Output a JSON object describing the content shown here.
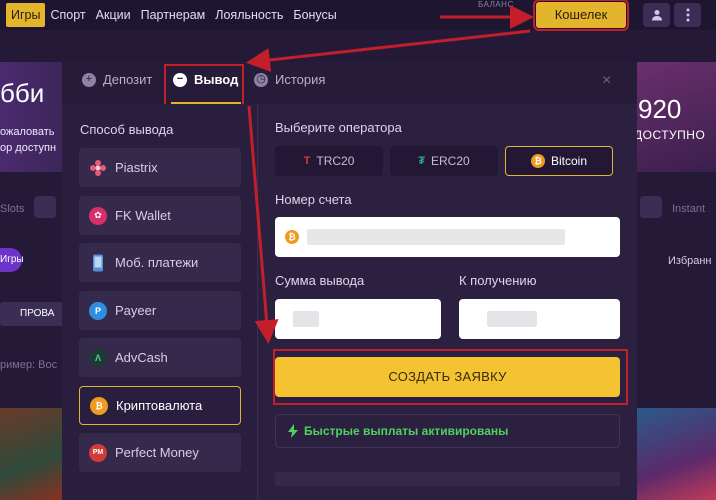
{
  "nav": {
    "items": [
      "Игры",
      "Спорт",
      "Акции",
      "Партнерам",
      "Лояльность",
      "Бонусы"
    ],
    "balance_label": "БАЛАНС",
    "wallet_button": "Кошелек"
  },
  "background": {
    "hero_text": "бби",
    "hero_line1": "ожаловать",
    "hero_line2": "ор доступн",
    "right_number": "920",
    "right_caption": "ДОСТУПНО",
    "slots": "Slots",
    "instant": "Instant",
    "pill": "Игры",
    "favorites": "Избранн",
    "promo": "ПРОВА",
    "search_placeholder": "ример: Вос"
  },
  "modal": {
    "tabs": [
      {
        "label": "Депозит",
        "icon": "plus-icon"
      },
      {
        "label": "Вывод",
        "icon": "minus-icon",
        "active": true
      },
      {
        "label": "История",
        "icon": "clock-icon"
      }
    ],
    "close": "×",
    "method_title": "Способ вывода",
    "methods": [
      {
        "label": "Piastrix",
        "icon": "piastrix-icon",
        "color": "#e85a7c"
      },
      {
        "label": "FK Wallet",
        "icon": "fkwallet-icon",
        "color": "#d62f6a"
      },
      {
        "label": "Моб. платежи",
        "icon": "phone-icon",
        "color": "#5a8fd8"
      },
      {
        "label": "Payeer",
        "icon": "payeer-icon",
        "color": "#2f8ee0"
      },
      {
        "label": "AdvCash",
        "icon": "advcash-icon",
        "color": "#1d3a35"
      },
      {
        "label": "Криптовалюта",
        "icon": "bitcoin-icon",
        "color": "#f09a1f",
        "selected": true
      },
      {
        "label": "Perfect Money",
        "icon": "perfectmoney-icon",
        "color": "#d33a3a"
      }
    ],
    "operator_title": "Выберите оператора",
    "operators": [
      {
        "label": "TRC20",
        "icon": "tron-icon",
        "color": "#e0332f"
      },
      {
        "label": "ERC20",
        "icon": "tether-icon",
        "color": "#2aa68a"
      },
      {
        "label": "Bitcoin",
        "icon": "bitcoin-icon",
        "color": "#f09a1f",
        "selected": true
      }
    ],
    "account_label": "Номер счета",
    "amount_label": "Сумма вывода",
    "receive_label": "К получению",
    "submit_button": "СОЗДАТЬ ЗАЯВКУ",
    "fast_payouts": "Быстрые выплаты активированы"
  },
  "colors": {
    "accent": "#e2b52d",
    "highlight": "#c21f2b",
    "success": "#4fd161"
  }
}
